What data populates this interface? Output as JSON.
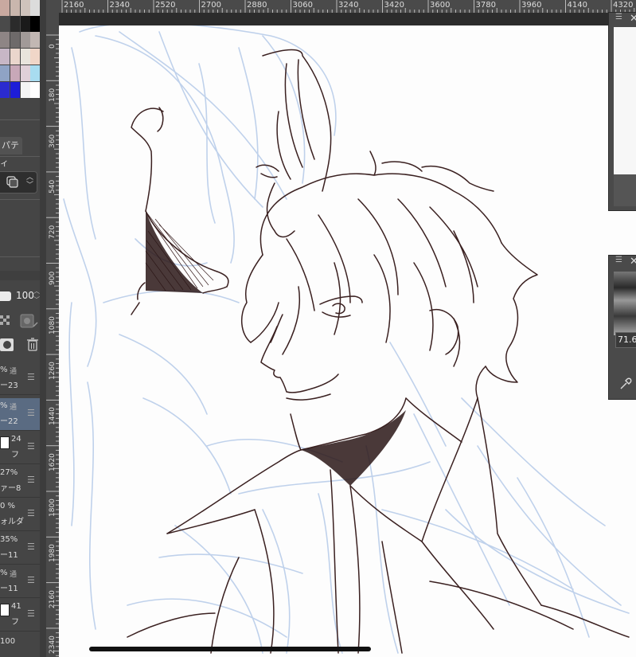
{
  "palette_colors": [
    "#c9a9a0",
    "#c9b6ad",
    "#cfc3bc",
    "#dcdcdc",
    "#4a4a4a",
    "#2b2b2b",
    "#1a1a1a",
    "#000000",
    "#8e8585",
    "#6e6a6a",
    "#a19a98",
    "#c2b7b3",
    "#c7b7c6",
    "#ead6cc",
    "#e8e4dc",
    "#f0d6c8",
    "#8fa3c5",
    "#c8a8b8",
    "#e0d0d8",
    "#a8dcf0",
    "#2b2bd0",
    "#1d1dd8",
    "#f4f4f4",
    "#ffffff"
  ],
  "left_panel": {
    "property_tab": "パティ",
    "opacity_value": "100",
    "layers": [
      {
        "l1": "%",
        "mode": "通",
        "l2": "ー23"
      },
      {
        "l1": "%",
        "mode": "通",
        "l2": "ー22"
      },
      {
        "l1": "24",
        "l2": "フ",
        "thumb": true
      },
      {
        "l1": "27%",
        "l2": "ァー8"
      },
      {
        "l1": "0 %",
        "l2": "ォルダ"
      },
      {
        "l1": "35%",
        "l2": "ー11"
      },
      {
        "l1": "%",
        "mode": "通",
        "l2": "ー11"
      },
      {
        "l1": "41",
        "l2": "フ",
        "thumb": true
      },
      {
        "l1": "100"
      }
    ]
  },
  "ruler_top": [
    "2160",
    "2340",
    "2520",
    "2700",
    "2880",
    "3060",
    "3240",
    "3420",
    "3600",
    "3780",
    "3960",
    "4140",
    "4320"
  ],
  "ruler_left": [
    "0",
    "180",
    "360",
    "540",
    "720",
    "900",
    "1080",
    "1260",
    "1440",
    "1620",
    "1800",
    "1980",
    "2160",
    "2340"
  ],
  "right_panel": {
    "zoom_value": "71.6"
  }
}
